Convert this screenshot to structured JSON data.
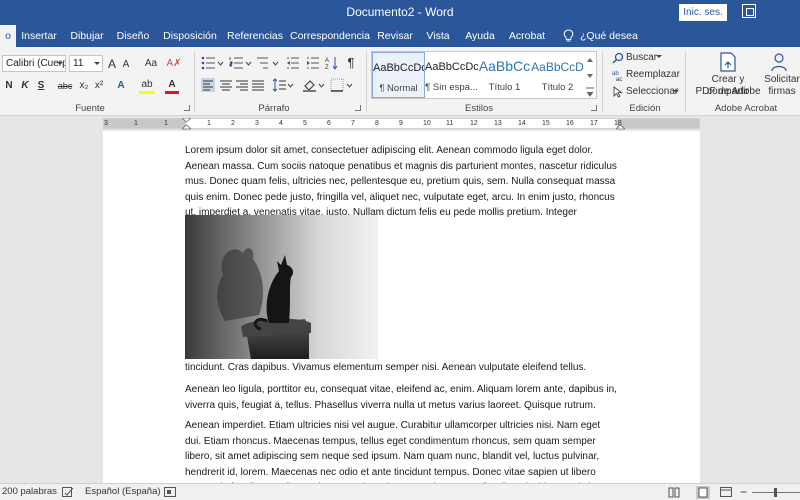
{
  "window": {
    "title": "Documento2  -  Word",
    "signin": "Inic. ses."
  },
  "tabs": [
    "o",
    "Insertar",
    "Dibujar",
    "Diseño",
    "Disposición",
    "Referencias",
    "Correspondencia",
    "Revisar",
    "Vista",
    "Ayuda",
    "Acrobat"
  ],
  "tellme": "¿Qué desea hacer?",
  "ribbon": {
    "font_name": "Calibri (Cuerpo",
    "font_size": "11",
    "group_fuente": "Fuente",
    "group_parrafo": "Párrafo",
    "group_estilos": "Estilos",
    "group_edicion": "Edición",
    "group_acrobat": "Adobe Acrobat",
    "bold": "N",
    "italic": "K",
    "underline": "S",
    "strike": "abc",
    "subscript": "x₂",
    "superscript": "x²",
    "grow_font": "A",
    "shrink_font": "A",
    "change_case": "Aa",
    "text_effects": "A",
    "highlight": "ab",
    "font_color": "A",
    "show_marks": "¶",
    "styles": [
      {
        "sample": "AaBbCcDc",
        "name": "¶ Normal"
      },
      {
        "sample": "AaBbCcDc",
        "name": "¶ Sin espa..."
      },
      {
        "sample": "AaBbCc",
        "name": "Título 1"
      },
      {
        "sample": "AaBbCcD",
        "name": "Título 2"
      }
    ],
    "buscar": "Buscar",
    "reemplazar": "Reemplazar",
    "seleccionar": "Seleccionar",
    "create_pdf_line1": "Crear y compartir",
    "create_pdf_line2": "PDF de Adobe",
    "request_sign_line1": "Solicitar",
    "request_sign_line2": "firmas",
    "colors": {
      "highlight": "#ffff00",
      "font_color": "#e81123",
      "accent": "#2b579a"
    }
  },
  "ruler": [
    "3",
    "1",
    "1",
    "1",
    "2",
    "3",
    "4",
    "5",
    "6",
    "7",
    "8",
    "9",
    "10",
    "11",
    "12",
    "13",
    "14",
    "15",
    "16",
    "17",
    "18"
  ],
  "document": {
    "para1": "Lorem ipsum dolor sit amet, consectetuer adipiscing elit. Aenean commodo ligula eget dolor. Aenean massa. Cum sociis natoque penatibus et magnis dis parturient montes, nascetur ridiculus mus. Donec quam felis, ultricies nec, pellentesque eu, pretium quis, sem. Nulla consequat massa quis enim. Donec pede justo, fringilla vel, aliquet nec, vulputate eget, arcu. In enim justo, rhoncus ut, imperdiet a, venenatis vitae, justo. Nullam dictum felis eu pede mollis pretium. Integer",
    "para1_cont": "tincidunt. Cras dapibus. Vivamus elementum semper nisi. Aenean vulputate eleifend tellus.",
    "para2": "Aenean leo ligula, porttitor eu, consequat vitae, eleifend ac, enim. Aliquam lorem ante, dapibus in, viverra quis, feugiat a, tellus. Phasellus viverra nulla ut metus varius laoreet. Quisque rutrum.",
    "para3": "Aenean imperdiet. Etiam ultricies nisi vel augue. Curabitur ullamcorper ultricies nisi. Nam eget dui. Etiam rhoncus. Maecenas tempus, tellus eget condimentum rhoncus, sem quam semper libero, sit amet adipiscing sem neque sed ipsum. Nam quam nunc, blandit vel, luctus pulvinar, hendrerit id, lorem. Maecenas nec odio et ante tincidunt tempus. Donec vitae sapien ut libero venenatis faucibus. Nullam quis ante. Etiam sit amet orci eget eros faucibus tincidunt. Duis leo. Sed fringilla"
  },
  "status": {
    "words": "200 palabras",
    "language": "Español (España)"
  }
}
